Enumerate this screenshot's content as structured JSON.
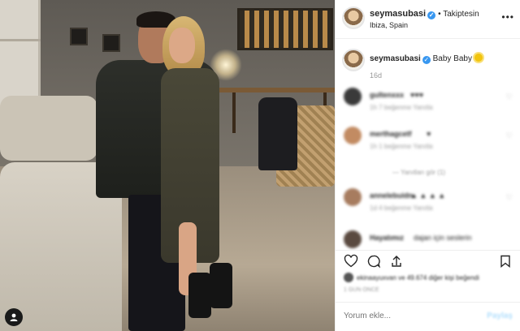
{
  "post": {
    "header": {
      "username": "seymasubasi",
      "verified_mark": "✓",
      "follow_status": "• Takiptesin",
      "location": "Ibiza, Spain",
      "more_icon": "more-icon"
    },
    "caption": {
      "username": "seymasubasi",
      "text": "Baby Baby",
      "emoji_icon": "sun-emoji-icon"
    },
    "time_ago": "16d",
    "comments": [
      {
        "user": "gultenxxx",
        "text": "♥♥♥",
        "meta": "1h  7 beğenme  Yanıtla"
      },
      {
        "user": "merthagcetf",
        "text": "♥",
        "meta": "1h  1 beğenme  Yanıtla"
      },
      {
        "replies": "— Yanıtları gör (1)"
      },
      {
        "user": "annelebuidn",
        "text": "▲ ▲ ▲ ▲",
        "meta": "1d  4 beğenme  Yanıtla"
      },
      {
        "user": "Hayatımız",
        "text": "dajan için seslerin",
        "meta": ""
      }
    ],
    "likes": "ekinaayuxvan ve 49.674 diğer kişi beğendi",
    "date": "1 GÜN ÖNCE",
    "comment_placeholder": "Yorum ekle...",
    "post_button": "Paylaş"
  },
  "colors": {
    "verified": "#3897f0",
    "text": "#262626",
    "muted": "#999999",
    "post_button": "#b2dffc"
  }
}
